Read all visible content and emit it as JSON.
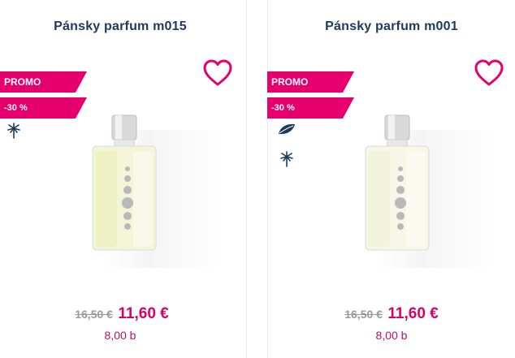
{
  "products": [
    {
      "name": "Pánsky parfum m015",
      "badge_promo": "PROMO",
      "badge_discount": "-30 %",
      "old_price": "16,50 €",
      "new_price": "11,60 €",
      "points": "8,00 b",
      "icons": [
        "palm-tree-icon"
      ]
    },
    {
      "name": "Pánsky parfum m001",
      "badge_promo": "PROMO",
      "badge_discount": "-30 %",
      "old_price": "16,50 €",
      "new_price": "11,60 €",
      "points": "8,00 b",
      "icons": [
        "leaf-icon",
        "palm-tree-icon"
      ]
    }
  ],
  "colors": {
    "accent": "#e6006e",
    "title": "#1e3a5c",
    "old_price": "#9a9a9a",
    "new_price": "#d6006a"
  }
}
